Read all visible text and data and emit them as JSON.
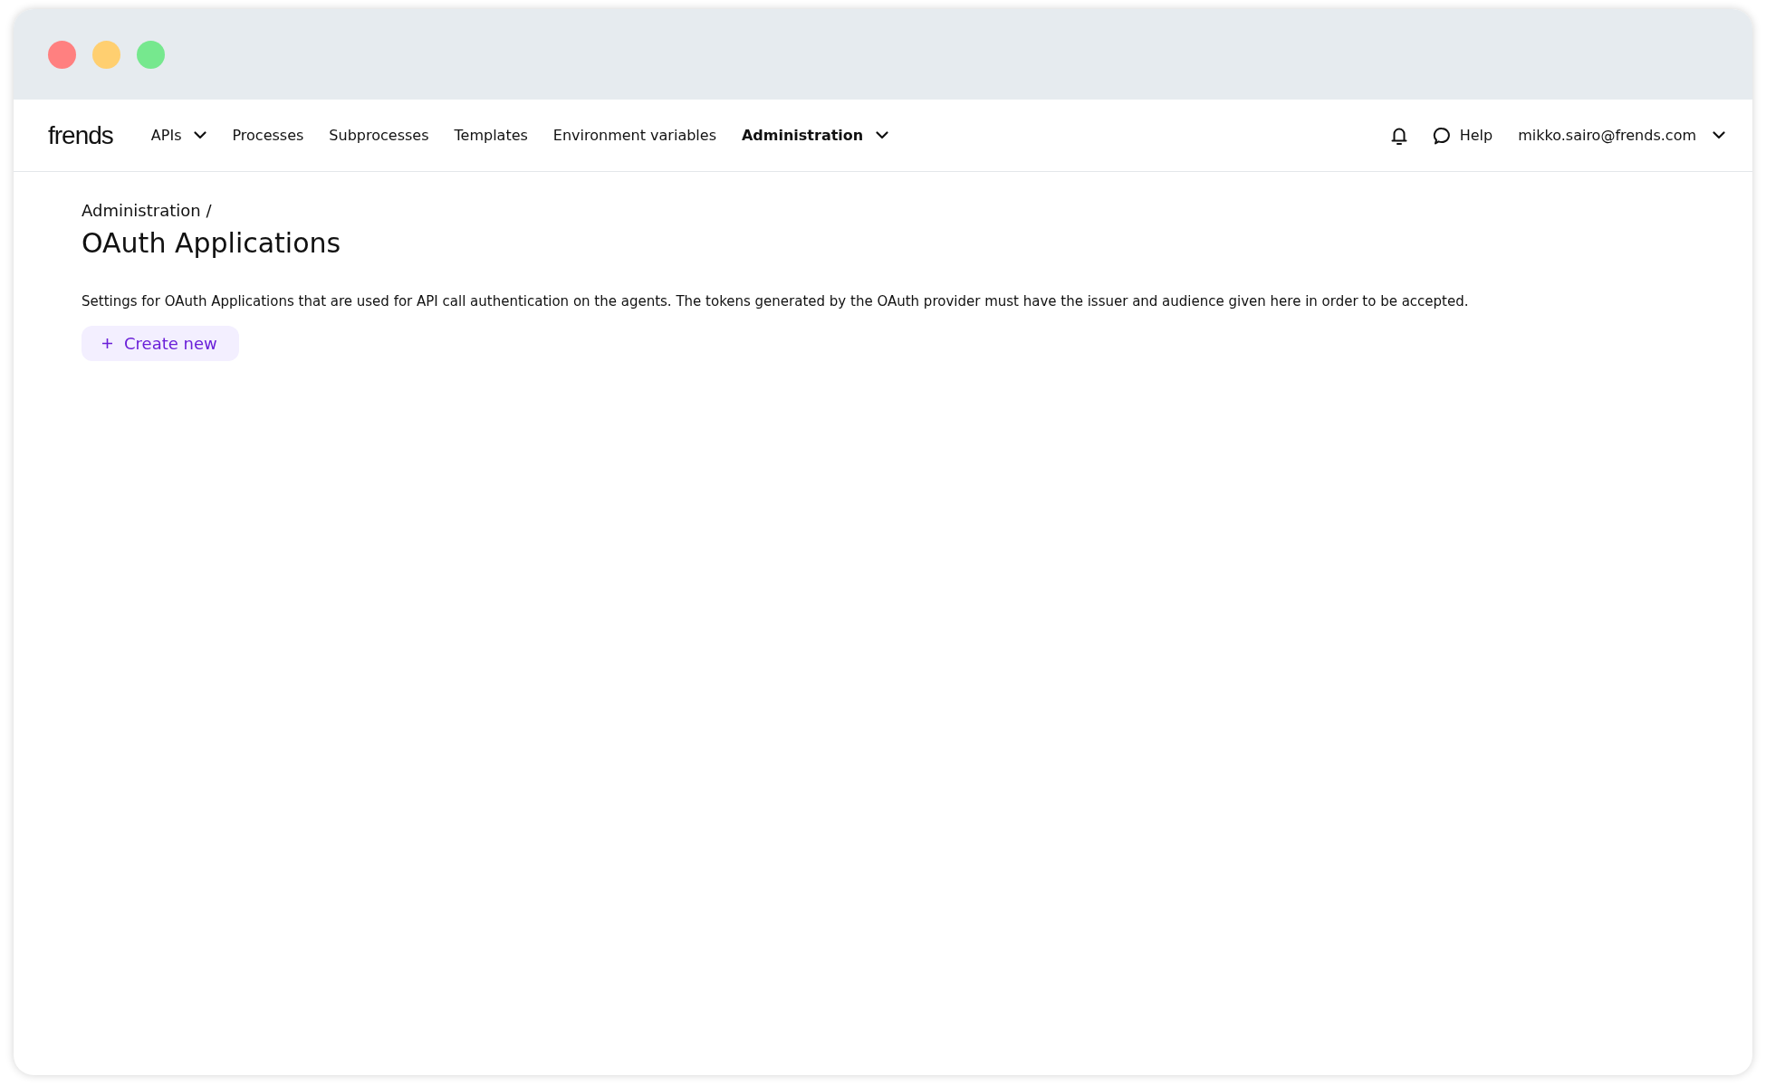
{
  "window": {
    "controls": [
      {
        "color": "#ff8080"
      },
      {
        "color": "#ffcf70"
      },
      {
        "color": "#76e88e"
      }
    ]
  },
  "nav": {
    "logo": "frends",
    "items": [
      {
        "label": "APIs",
        "kind": "dropdown",
        "selected": false
      },
      {
        "label": "Processes",
        "kind": "link",
        "selected": false
      },
      {
        "label": "Subprocesses",
        "kind": "link",
        "selected": false
      },
      {
        "label": "Templates",
        "kind": "link",
        "selected": false
      },
      {
        "label": "Environment variables",
        "kind": "link",
        "selected": false
      },
      {
        "label": "Administration",
        "kind": "dropdown",
        "selected": true
      }
    ],
    "help": "Help",
    "user": "mikko.sairo@frends.com"
  },
  "page": {
    "breadcrumb": "Administration /",
    "title": "OAuth Applications",
    "description": "Settings for OAuth Applications that are used for API call authentication on the agents. The tokens generated by the OAuth provider must have the issuer and audience given here in order to be accepted.",
    "create_button": "Create new"
  }
}
